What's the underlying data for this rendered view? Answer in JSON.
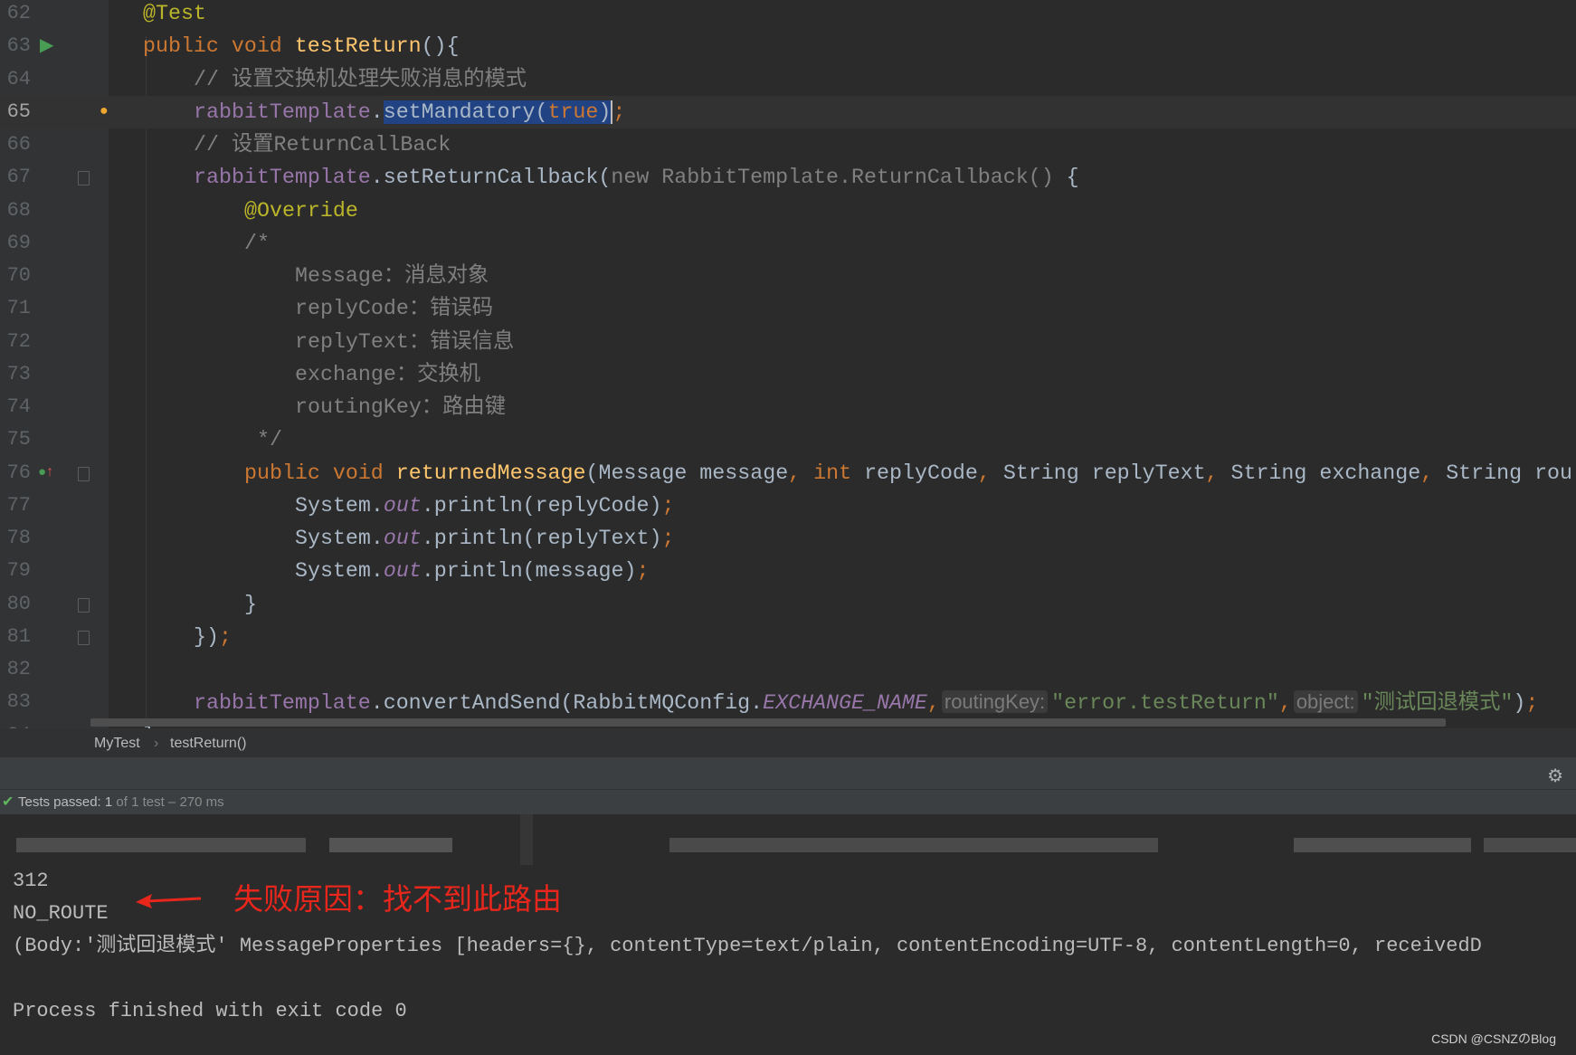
{
  "editor": {
    "lines": [
      {
        "n": "62",
        "indent": 0,
        "tokens": [
          {
            "k": "an",
            "t": "@Test"
          }
        ]
      },
      {
        "n": "63",
        "indent": 0,
        "icon": "run-test-icon",
        "tokens": [
          {
            "k": "kw",
            "t": "public void "
          },
          {
            "k": "fn",
            "t": "testReturn"
          },
          {
            "k": "tx",
            "t": "(){"
          }
        ]
      },
      {
        "n": "64",
        "indent": 1,
        "tokens": [
          {
            "k": "cm",
            "t": "// 设置交换机处理失败消息的模式"
          }
        ]
      },
      {
        "n": "65",
        "indent": 1,
        "current": true,
        "icon": "lightbulb-icon",
        "tokens": [
          {
            "k": "fld",
            "t": "rabbitTemplate"
          },
          {
            "k": "tx",
            "t": "."
          },
          {
            "k": "tx sel",
            "t": "setMandatory("
          },
          {
            "k": "kw sel",
            "t": "true"
          },
          {
            "k": "tx sel",
            "t": ")"
          },
          {
            "k": "caret",
            "t": ""
          },
          {
            "k": "kw",
            "t": ";"
          }
        ]
      },
      {
        "n": "66",
        "indent": 1,
        "tokens": [
          {
            "k": "cm",
            "t": "// 设置ReturnCallBack"
          }
        ]
      },
      {
        "n": "67",
        "indent": 1,
        "fold": true,
        "tokens": [
          {
            "k": "fld",
            "t": "rabbitTemplate"
          },
          {
            "k": "tx",
            "t": ".setReturnCallback("
          },
          {
            "k": "gr",
            "t": "new RabbitTemplate.ReturnCallback()"
          },
          {
            "k": "tx",
            "t": " {"
          }
        ]
      },
      {
        "n": "68",
        "indent": 2,
        "tokens": [
          {
            "k": "an",
            "t": "@Override"
          }
        ]
      },
      {
        "n": "69",
        "indent": 2,
        "tokens": [
          {
            "k": "cm",
            "t": "/*"
          }
        ]
      },
      {
        "n": "70",
        "indent": 3,
        "tokens": [
          {
            "k": "cm",
            "t": "Message：消息对象"
          }
        ]
      },
      {
        "n": "71",
        "indent": 3,
        "tokens": [
          {
            "k": "cm",
            "t": "replyCode：错误码"
          }
        ]
      },
      {
        "n": "72",
        "indent": 3,
        "tokens": [
          {
            "k": "cm",
            "t": "replyText：错误信息"
          }
        ]
      },
      {
        "n": "73",
        "indent": 3,
        "tokens": [
          {
            "k": "cm",
            "t": "exchange：交换机"
          }
        ]
      },
      {
        "n": "74",
        "indent": 3,
        "tokens": [
          {
            "k": "cm",
            "t": "routingKey：路由键"
          }
        ]
      },
      {
        "n": "75",
        "indent": 2,
        "tokens": [
          {
            "k": "cm",
            "t": " */"
          }
        ]
      },
      {
        "n": "76",
        "indent": 2,
        "fold": true,
        "icon": "implements-method-icon",
        "tokens": [
          {
            "k": "kw",
            "t": "public void "
          },
          {
            "k": "fn",
            "t": "returnedMessage"
          },
          {
            "k": "tx",
            "t": "(Message message"
          },
          {
            "k": "kw",
            "t": ", int "
          },
          {
            "k": "tx",
            "t": "replyCode"
          },
          {
            "k": "kw",
            "t": ", "
          },
          {
            "k": "tx",
            "t": "String replyText"
          },
          {
            "k": "kw",
            "t": ", "
          },
          {
            "k": "tx",
            "t": "String exchange"
          },
          {
            "k": "kw",
            "t": ", "
          },
          {
            "k": "tx",
            "t": "String rou"
          }
        ]
      },
      {
        "n": "77",
        "indent": 3,
        "tokens": [
          {
            "k": "tx",
            "t": "System."
          },
          {
            "k": "sf",
            "t": "out"
          },
          {
            "k": "tx",
            "t": ".println(replyCode)"
          },
          {
            "k": "kw",
            "t": ";"
          }
        ]
      },
      {
        "n": "78",
        "indent": 3,
        "tokens": [
          {
            "k": "tx",
            "t": "System."
          },
          {
            "k": "sf",
            "t": "out"
          },
          {
            "k": "tx",
            "t": ".println(replyText)"
          },
          {
            "k": "kw",
            "t": ";"
          }
        ]
      },
      {
        "n": "79",
        "indent": 3,
        "tokens": [
          {
            "k": "tx",
            "t": "System."
          },
          {
            "k": "sf",
            "t": "out"
          },
          {
            "k": "tx",
            "t": ".println(message)"
          },
          {
            "k": "kw",
            "t": ";"
          }
        ]
      },
      {
        "n": "80",
        "indent": 2,
        "fold": true,
        "tokens": [
          {
            "k": "tx",
            "t": "}"
          }
        ]
      },
      {
        "n": "81",
        "indent": 1,
        "fold": true,
        "tokens": [
          {
            "k": "tx",
            "t": "})"
          },
          {
            "k": "kw",
            "t": ";"
          }
        ]
      },
      {
        "n": "82",
        "indent": 0,
        "tokens": []
      },
      {
        "n": "83",
        "indent": 1,
        "tokens": [
          {
            "k": "fld",
            "t": "rabbitTemplate"
          },
          {
            "k": "tx",
            "t": ".convertAndSend(RabbitMQConfig."
          },
          {
            "k": "sf",
            "t": "EXCHANGE_NAME"
          },
          {
            "k": "kw",
            "t": ","
          },
          {
            "k": "hint",
            "t": "routingKey:"
          },
          {
            "k": "st",
            "t": "\"error.testReturn\""
          },
          {
            "k": "kw",
            "t": ","
          },
          {
            "k": "hint",
            "t": "object:"
          },
          {
            "k": "st",
            "t": "\"测试回退模式\""
          },
          {
            "k": "tx",
            "t": ")"
          },
          {
            "k": "kw",
            "t": ";"
          }
        ]
      },
      {
        "n": "84",
        "indent": 0,
        "fold": true,
        "tokens": [
          {
            "k": "tx",
            "t": "}"
          }
        ]
      }
    ]
  },
  "breadcrumb": {
    "items": [
      "MyTest",
      "testReturn()"
    ],
    "separator": "›"
  },
  "run_panel": {
    "settings_icon": "gear-icon",
    "status": {
      "label": "Tests passed:",
      "count": "1",
      "detail": " of 1 test – 270 ms"
    }
  },
  "console": {
    "lines": [
      "312",
      "NO_ROUTE",
      "(Body:'测试回退模式' MessageProperties [headers={}, contentType=text/plain, contentEncoding=UTF-8, contentLength=0, receivedD",
      "",
      "Process finished with exit code 0"
    ]
  },
  "annotation": {
    "text": "失败原因：找不到此路由",
    "color": "#e8261c"
  },
  "watermark": "CSDN @CSNZのBlog",
  "colors": {
    "keyword": "#cc7832",
    "method": "#ffc66d",
    "comment": "#808080",
    "field": "#9876aa",
    "string": "#6a8759",
    "annotation": "#bbb529",
    "selection": "#214283"
  }
}
